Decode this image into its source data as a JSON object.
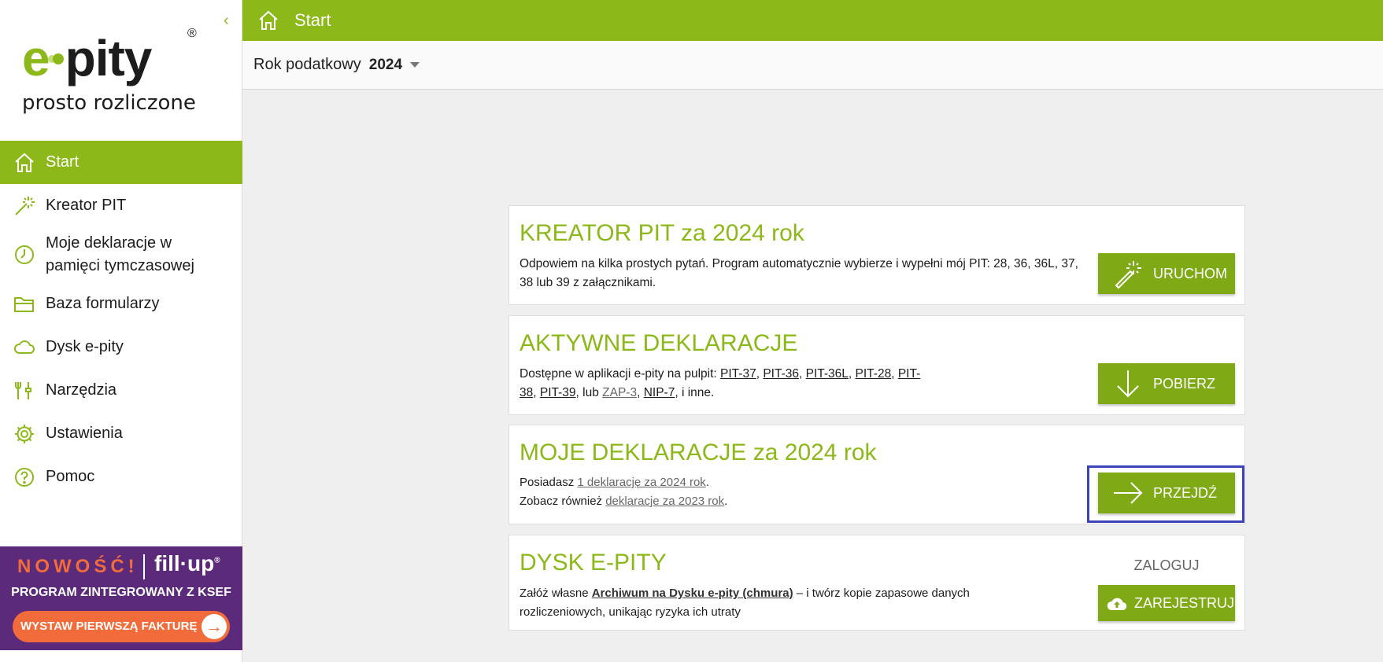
{
  "app": {
    "logo_text": "e-pity",
    "logo_reg": "®",
    "tagline": "prosto rozliczone",
    "accent_color": "#8cb819"
  },
  "sidebar": {
    "collapse_icon": "chevron-left-icon",
    "items": [
      {
        "label": "Start",
        "icon": "home-icon",
        "active": true
      },
      {
        "label": "Kreator PIT",
        "icon": "magic-wand-icon"
      },
      {
        "label": "Moje deklaracje w pamięci tymczasowej",
        "icon": "clock-icon"
      },
      {
        "label": "Baza formularzy",
        "icon": "folder-icon"
      },
      {
        "label": "Dysk e-pity",
        "icon": "cloud-icon"
      },
      {
        "label": "Narzędzia",
        "icon": "tools-icon"
      },
      {
        "label": "Ustawienia",
        "icon": "gear-icon"
      },
      {
        "label": "Pomoc",
        "icon": "help-icon"
      }
    ]
  },
  "promo": {
    "badge": "NOWOŚĆ!",
    "brand": "fill·up",
    "brand_reg": "®",
    "subtitle": "PROGRAM ZINTEGROWANY Z KSEF",
    "button": "WYSTAW PIERWSZĄ FAKTURĘ",
    "background": "#5b2a7b",
    "accent": "#f26b3a"
  },
  "header": {
    "title": "Start",
    "year_label": "Rok podatkowy",
    "year_value": "2024"
  },
  "cards": {
    "kreator": {
      "title": "KREATOR PIT za 2024 rok",
      "text": "Odpowiem na kilka prostych pytań. Program automatycznie wybierze i wypełni mój PIT: 28, 36, 36L, 37, 38 lub 39 z załącznikami.",
      "button": "URUCHOM"
    },
    "aktywne": {
      "title": "AKTYWNE DEKLARACJE",
      "text_prefix": "Dostępne w aplikacji e-pity na pulpit: ",
      "links": [
        "PIT-37",
        "PIT-36",
        "PIT-36L",
        "PIT-28",
        "PIT-38",
        "PIT-39",
        "ZAP-3",
        "NIP-7"
      ],
      "sep_comma": ", ",
      "sep_lub": ", lub ",
      "text_suffix": ", i inne.",
      "button": "POBIERZ"
    },
    "moje": {
      "title": "MOJE DEKLARACJE za 2024 rok",
      "line1_prefix": "Posiadasz ",
      "line1_link": "1 deklarację za 2024 rok",
      "line1_suffix": ".",
      "line2_prefix": "Zobacz również ",
      "line2_link": "deklaracje za 2023 rok",
      "line2_suffix": ".",
      "button": "PRZEJDŹ"
    },
    "dysk": {
      "title": "DYSK E-PITY",
      "text_prefix": "Załóż własne ",
      "text_link": "Archiwum na Dysku e-pity (chmura)",
      "text_suffix": " – i twórz kopie zapasowe danych rozliczeniowych, unikając ryzyka ich utraty",
      "login": "ZALOGUJ",
      "button": "ZAREJESTRUJ"
    }
  }
}
